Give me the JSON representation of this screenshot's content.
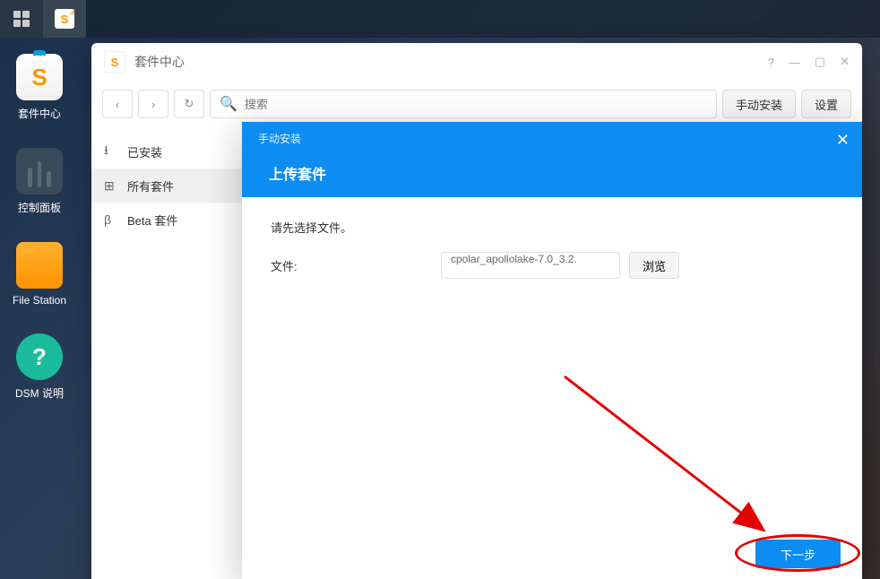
{
  "taskbar": {
    "app_icon_letter": "S"
  },
  "desktop": {
    "icons": [
      {
        "label": "套件中心",
        "letter": "S"
      },
      {
        "label": "控制面板"
      },
      {
        "label": "File Station"
      },
      {
        "label": "DSM 说明",
        "letter": "?"
      }
    ]
  },
  "window": {
    "title": "套件中心",
    "icon_letter": "S",
    "search_placeholder": "搜索",
    "manual_install_label": "手动安装",
    "settings_label": "设置",
    "sidebar": {
      "installed": "已安装",
      "all_packages": "所有套件",
      "beta": "Beta 套件"
    }
  },
  "modal": {
    "small_title": "手动安装",
    "big_title": "上传套件",
    "prompt": "请先选择文件。",
    "file_label": "文件:",
    "file_value": "cpolar_apollolake-7.0_3.2.",
    "browse_label": "浏览",
    "next_label": "下一步"
  }
}
